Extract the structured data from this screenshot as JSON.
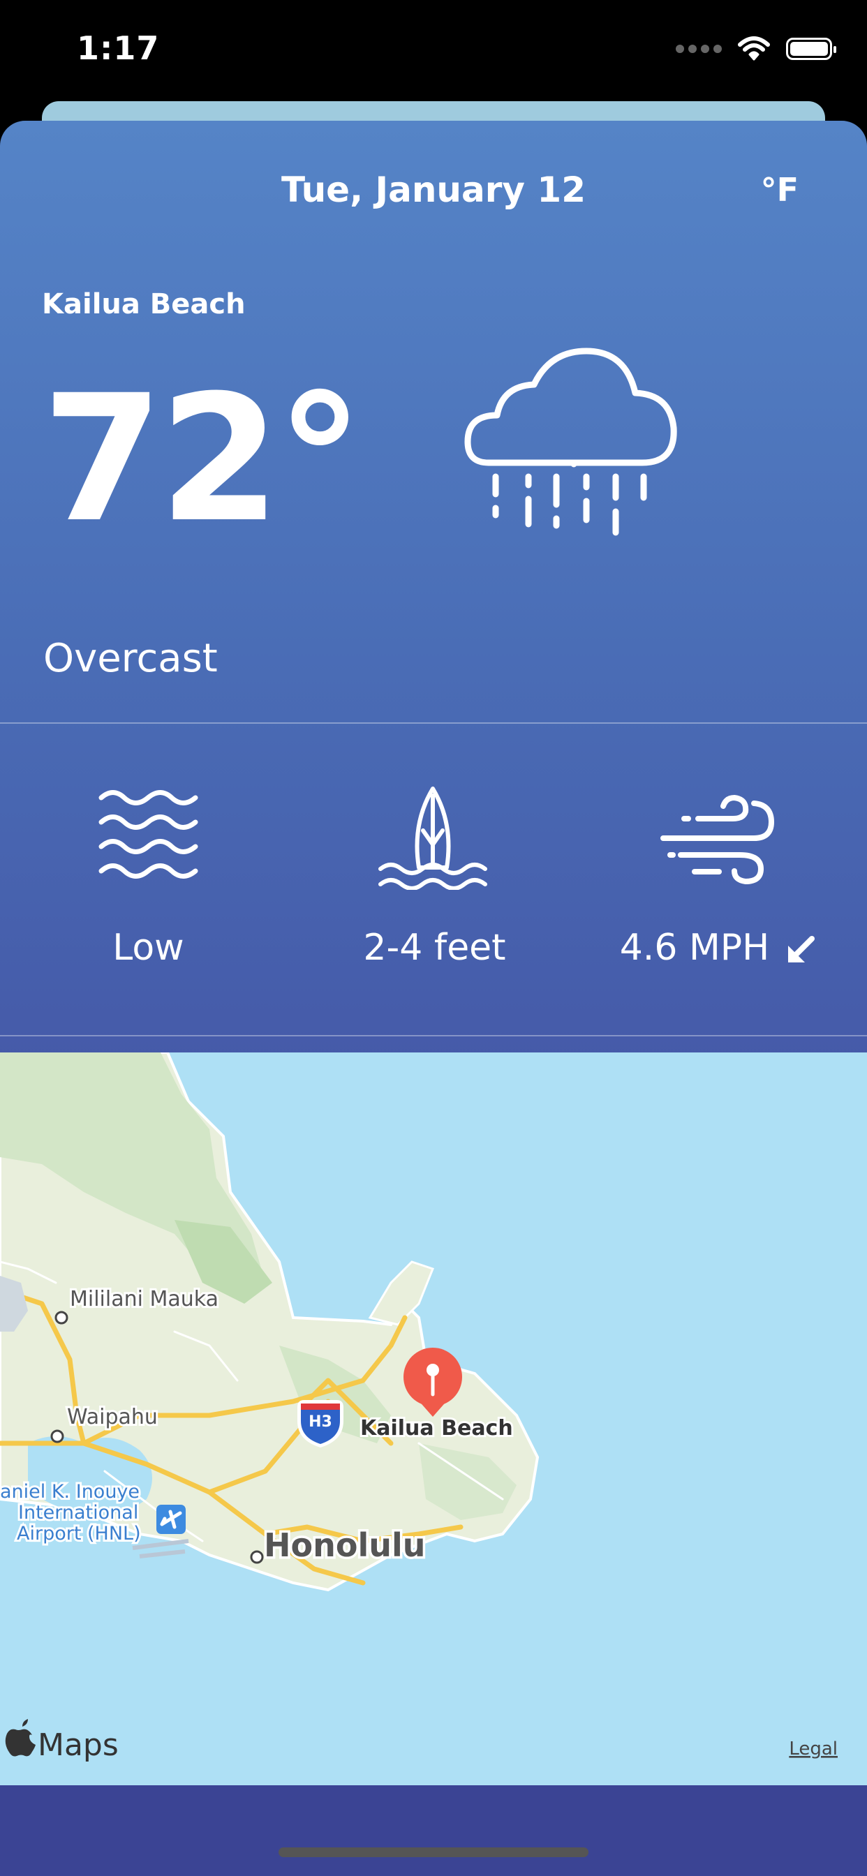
{
  "status_bar": {
    "time": "1:17"
  },
  "header": {
    "date": "Tue, January 12",
    "unit_toggle": "°F"
  },
  "current": {
    "location": "Kailua Beach",
    "temperature": "72°",
    "condition": "Overcast",
    "icon": "rain-cloud-icon"
  },
  "metrics": {
    "tide": {
      "label": "Low",
      "icon": "waves-icon"
    },
    "surf": {
      "label": "2-4 feet",
      "icon": "surfboard-icon"
    },
    "wind": {
      "label": "4.6 MPH",
      "icon": "wind-icon",
      "direction_icon": "arrow-down-left-icon"
    }
  },
  "map": {
    "labels": {
      "mililani": "Mililani Mauka",
      "waipahu": "Waipahu",
      "airport_1": "aniel K. Inouye",
      "airport_2": "International",
      "airport_3": "Airport (HNL)",
      "honolulu": "Honolulu",
      "pin_label": "Kailua Beach",
      "highway": "H3"
    },
    "attribution": "Maps",
    "legal": "Legal"
  },
  "colors": {
    "accent_pin": "#f05a4a",
    "ocean": "#aee0f5",
    "land": "#e6efdb",
    "gradient_top": "#5584c7",
    "gradient_bottom": "#3f4797"
  }
}
